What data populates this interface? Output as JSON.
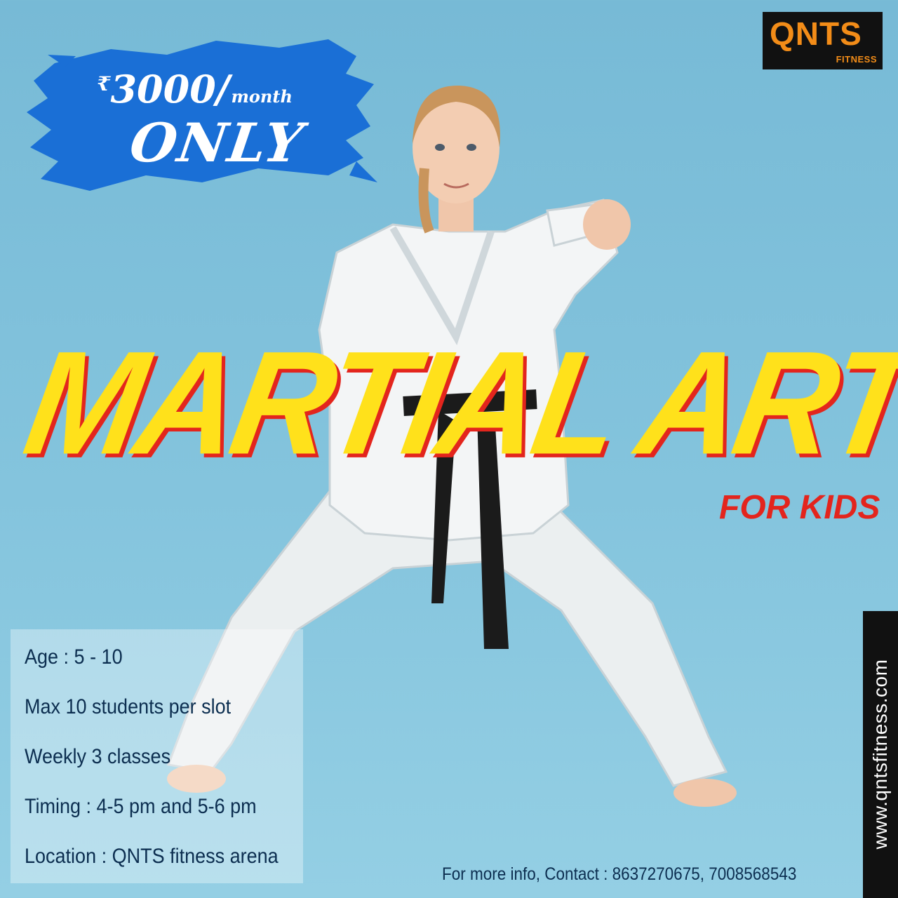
{
  "brand": {
    "logo_main": "QNTS",
    "logo_sub": "FITNESS",
    "website": "www.qntsfitness.com"
  },
  "price": {
    "currency_symbol": "₹",
    "amount": "3000/",
    "period": "month",
    "qualifier": "ONLY"
  },
  "headline": {
    "title": "MARTIAL ARTS",
    "subtitle": "FOR KIDS"
  },
  "details": [
    "Age : 5 - 10",
    "Max 10 students per slot",
    "Weekly 3 classes",
    "Timing : 4-5 pm and 5-6 pm",
    "Location : QNTS fitness arena"
  ],
  "contact": "For more info, Contact : 8637270675, 7008568543",
  "colors": {
    "background": "#84c4dd",
    "badge_blue": "#1a6fd6",
    "title_yellow": "#ffe11b",
    "title_red": "#e3251d",
    "logo_orange": "#f28c18",
    "text_navy": "#0c2e50"
  }
}
